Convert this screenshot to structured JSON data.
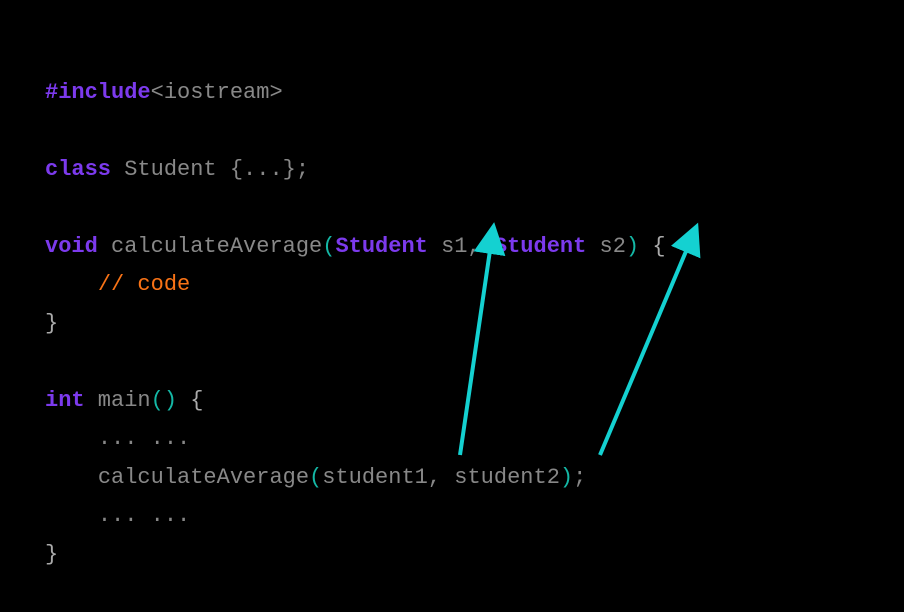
{
  "code": {
    "line1": {
      "include_kw": "#include",
      "header": "<iostream>"
    },
    "line3": {
      "class_kw": "class",
      "class_name": " Student ",
      "rest": "{...};"
    },
    "line5": {
      "void_kw": "void",
      "func_name": " calculateAverage",
      "paren_open": "(",
      "type1": "Student",
      "param1": " s1",
      "comma": ", ",
      "type2": "Student",
      "param2": " s2",
      "paren_close": ")",
      "brace": " {"
    },
    "line6": {
      "indent": "    ",
      "comment": "// code"
    },
    "line7": {
      "brace": "}"
    },
    "line9": {
      "int_kw": "int",
      "main": " main",
      "parens": "()",
      "brace": " {"
    },
    "line10": {
      "indent": "    ",
      "dots": "... ..."
    },
    "line11": {
      "indent": "    ",
      "call": "calculateAverage",
      "paren_open": "(",
      "arg1": "student1",
      "comma": ", ",
      "arg2": "student2",
      "paren_close": ")",
      "semi": ";"
    },
    "line12": {
      "indent": "    ",
      "dots": "... ..."
    },
    "line13": {
      "brace": "}"
    }
  },
  "arrow_color": "#14d1d1"
}
